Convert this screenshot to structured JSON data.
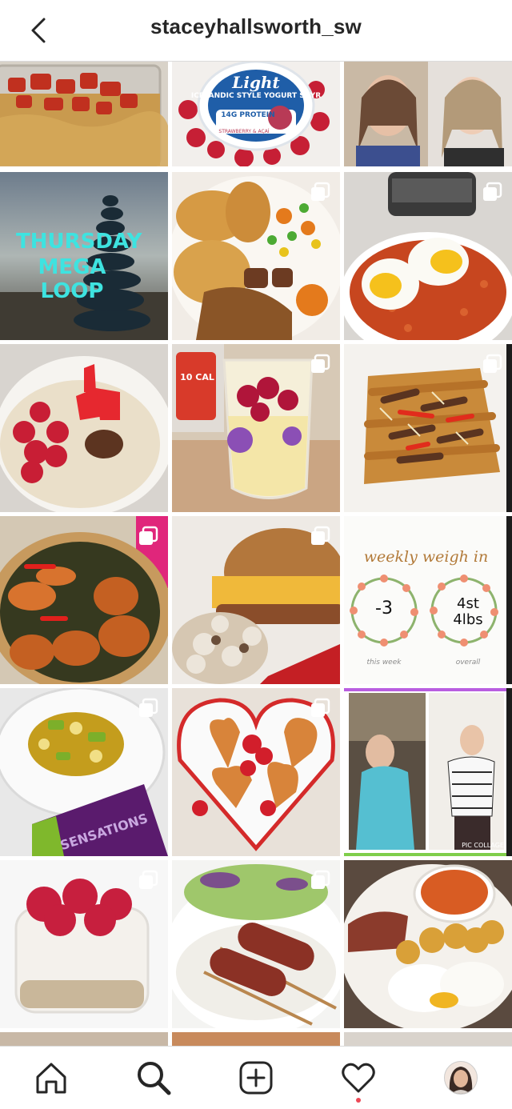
{
  "header": {
    "username": "staceyhallsworth_sw",
    "back_icon": "chevron-left-icon"
  },
  "grid": {
    "posts": [
      {
        "id": "food-tray",
        "multi": false
      },
      {
        "id": "skyr-yogurt",
        "multi": false,
        "text": {
          "brand": "Light",
          "product": "ICELANDIC STYLE YOGURT SKYR",
          "protein": "14G PROTEIN",
          "flavour": "STRAWBERRY & AÇAÍ"
        }
      },
      {
        "id": "selfie-pair",
        "multi": false
      },
      {
        "id": "mega-loop",
        "multi": false,
        "text": {
          "line1": "THURSDAY",
          "line2": "MEGA LOOP"
        }
      },
      {
        "id": "stew-potatoes",
        "multi": true
      },
      {
        "id": "beans-eggs",
        "multi": true
      },
      {
        "id": "porridge-raspberries",
        "multi": true
      },
      {
        "id": "yogurt-glass",
        "multi": true,
        "text": {
          "cup": "10 CAL"
        }
      },
      {
        "id": "steak-fries",
        "multi": true
      },
      {
        "id": "chicken-rice-bowl",
        "multi": true
      },
      {
        "id": "burger",
        "multi": true
      },
      {
        "id": "weekly-weigh-in",
        "multi": false,
        "text": {
          "title": "weekly weigh in",
          "left_value": "-3",
          "left_caption": "this week",
          "right_value": "4st 4lbs",
          "right_caption": "overall"
        }
      },
      {
        "id": "curry-crisps",
        "multi": true,
        "text": {
          "bag": "SENSATIONS"
        }
      },
      {
        "id": "heart-plate",
        "multi": true
      },
      {
        "id": "before-after",
        "multi": false,
        "text": {
          "watermark": "PIC COLLAGE"
        }
      },
      {
        "id": "raspberry-cheesecake",
        "multi": true
      },
      {
        "id": "kofta-rice",
        "multi": true
      },
      {
        "id": "breakfast-plate",
        "multi": false
      }
    ]
  },
  "nav": {
    "items": [
      {
        "name": "home",
        "icon": "home-icon"
      },
      {
        "name": "search",
        "icon": "search-icon"
      },
      {
        "name": "new-post",
        "icon": "plus-square-icon"
      },
      {
        "name": "activity",
        "icon": "heart-icon"
      },
      {
        "name": "profile",
        "icon": "avatar"
      }
    ],
    "accent": "#ed4956"
  }
}
